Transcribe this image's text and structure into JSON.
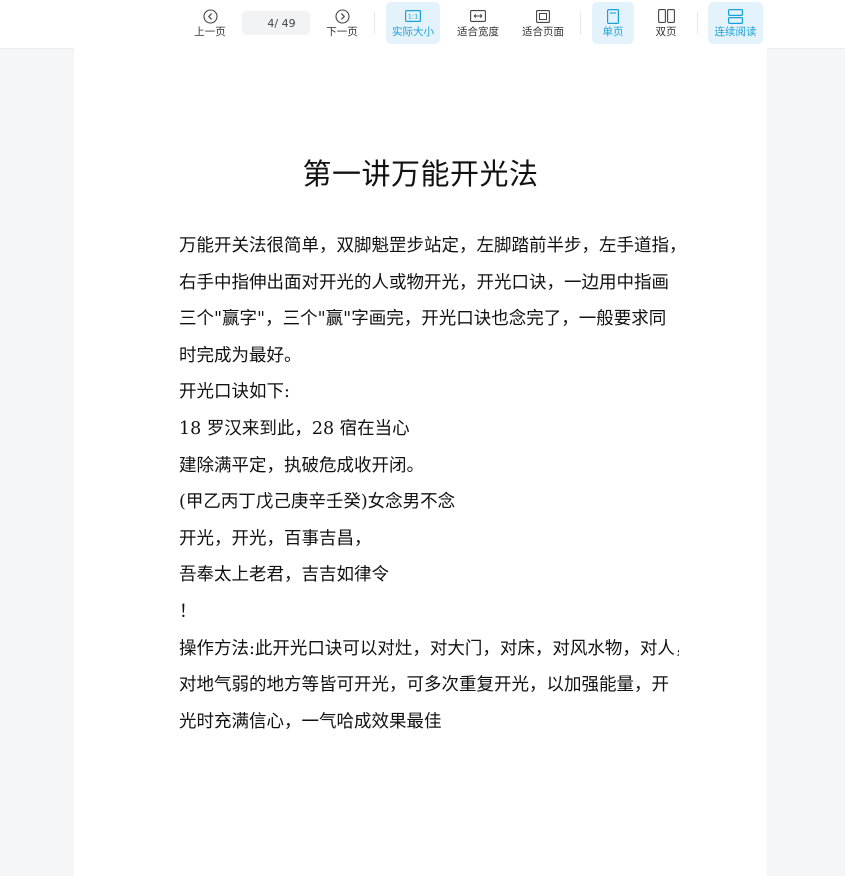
{
  "toolbar": {
    "prev_label": "上一页",
    "next_label": "下一页",
    "current_page": "4",
    "total_pages": "/ 49",
    "actual_size_label": "实际大小",
    "fit_width_label": "适合宽度",
    "fit_page_label": "适合页面",
    "single_page_label": "单页",
    "double_page_label": "双页",
    "continuous_label": "连续阅读",
    "accent_color": "#1aa0d8"
  },
  "document": {
    "title": "第一讲万能开光法",
    "lines": [
      "万能开关法很简单，双脚魁罡步站定，左脚踏前半步，左手道指，",
      "右手中指伸出面对开光的人或物开光，开光口诀，一边用中指画",
      "三个\"赢字\"，三个\"赢\"字画完，开光口诀也念完了，一般要求同",
      "时完成为最好。",
      "开光口诀如下:",
      "18 罗汉来到此，28 宿在当心",
      "建除满平定，执破危成收开闭。",
      "(甲乙丙丁戊己庚辛壬癸)女念男不念",
      "开光，开光，百事吉昌，",
      "吾奉太上老君，吉吉如律令",
      "！",
      "操作方法:此开光口诀可以对灶，对大门，对床，对风水物，对人，",
      "对地气弱的地方等皆可开光，可多次重复开光，以加强能量，开",
      "光时充满信心，一气哈成效果最佳"
    ]
  }
}
